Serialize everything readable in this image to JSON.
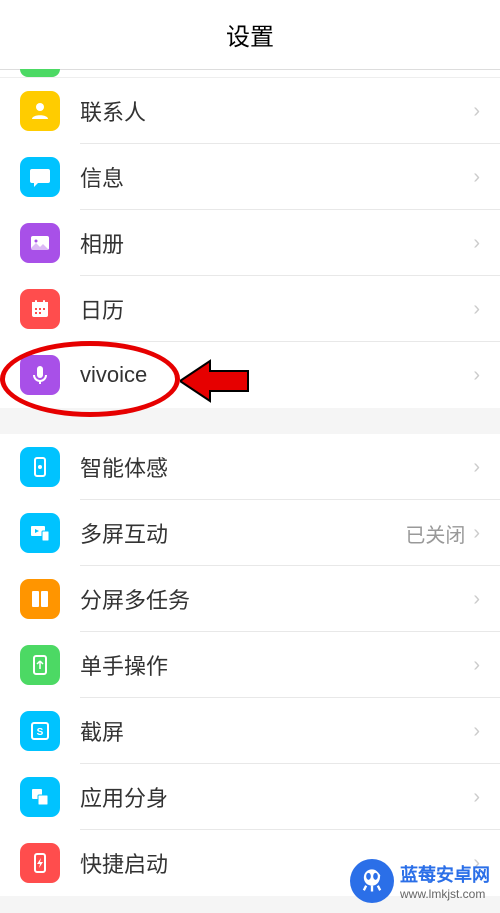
{
  "header": {
    "title": "设置"
  },
  "group1": {
    "items": [
      {
        "label": "联系人",
        "icon": "contacts-icon"
      },
      {
        "label": "信息",
        "icon": "messages-icon"
      },
      {
        "label": "相册",
        "icon": "photos-icon"
      },
      {
        "label": "日历",
        "icon": "calendar-icon"
      },
      {
        "label": "vivoice",
        "icon": "vivoice-icon"
      }
    ]
  },
  "group2": {
    "items": [
      {
        "label": "智能体感",
        "icon": "motion-icon",
        "value": ""
      },
      {
        "label": "多屏互动",
        "icon": "multiscreen-icon",
        "value": "已关闭"
      },
      {
        "label": "分屏多任务",
        "icon": "splitscreen-icon",
        "value": ""
      },
      {
        "label": "单手操作",
        "icon": "onehand-icon",
        "value": ""
      },
      {
        "label": "截屏",
        "icon": "screenshot-icon",
        "value": ""
      },
      {
        "label": "应用分身",
        "icon": "appclone-icon",
        "value": ""
      },
      {
        "label": "快捷启动",
        "icon": "quicklaunch-icon",
        "value": ""
      }
    ]
  },
  "watermark": {
    "title": "蓝莓安卓网",
    "url": "www.lmkjst.com"
  }
}
